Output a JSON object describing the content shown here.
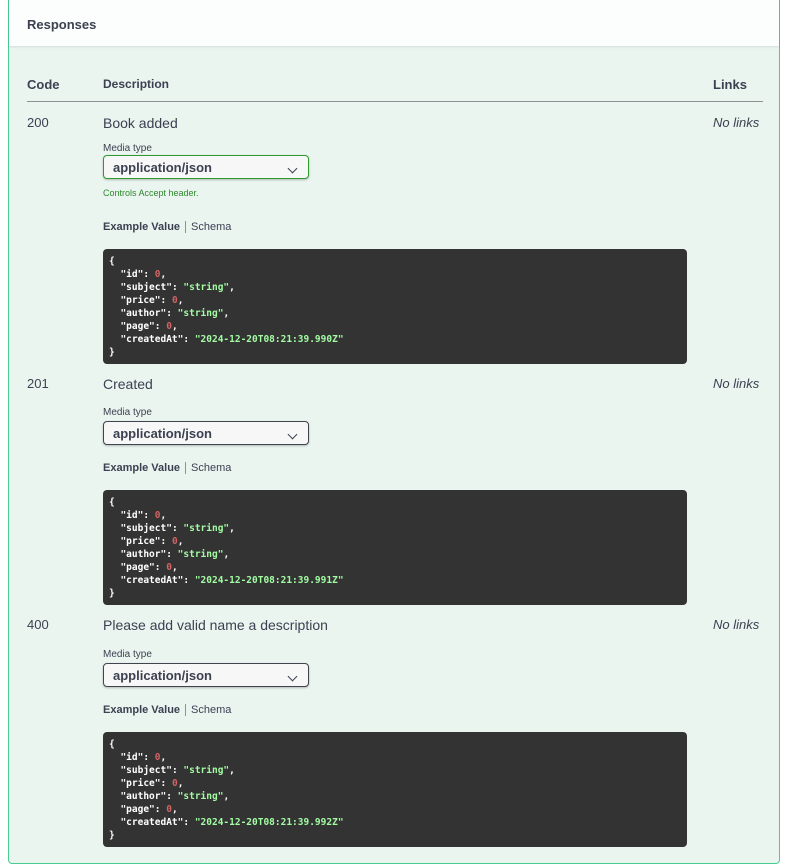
{
  "panel": {
    "title": "Responses",
    "headers": {
      "code": "Code",
      "description": "Description",
      "links": "Links"
    },
    "media_type_label": "Media type",
    "tab_example": "Example Value",
    "tab_schema": "Schema",
    "controls_note": "Controls Accept header."
  },
  "responses": [
    {
      "code": "200",
      "description": "Book added",
      "links": "No links",
      "media_type": "application/json",
      "example": {
        "open": "{",
        "close": "}",
        "fields": [
          {
            "key": "\"id\"",
            "value": "0",
            "type": "number",
            "sep": ","
          },
          {
            "key": "\"subject\"",
            "value": "\"string\"",
            "type": "string",
            "sep": ","
          },
          {
            "key": "\"price\"",
            "value": "0",
            "type": "number",
            "sep": ","
          },
          {
            "key": "\"author\"",
            "value": "\"string\"",
            "type": "string",
            "sep": ","
          },
          {
            "key": "\"page\"",
            "value": "0",
            "type": "number",
            "sep": ","
          },
          {
            "key": "\"createdAt\"",
            "value": "\"2024-12-20T08:21:39.990Z\"",
            "type": "string",
            "sep": ""
          }
        ]
      }
    },
    {
      "code": "201",
      "description": "Created",
      "links": "No links",
      "media_type": "application/json",
      "example": {
        "open": "{",
        "close": "}",
        "fields": [
          {
            "key": "\"id\"",
            "value": "0",
            "type": "number",
            "sep": ","
          },
          {
            "key": "\"subject\"",
            "value": "\"string\"",
            "type": "string",
            "sep": ","
          },
          {
            "key": "\"price\"",
            "value": "0",
            "type": "number",
            "sep": ","
          },
          {
            "key": "\"author\"",
            "value": "\"string\"",
            "type": "string",
            "sep": ","
          },
          {
            "key": "\"page\"",
            "value": "0",
            "type": "number",
            "sep": ","
          },
          {
            "key": "\"createdAt\"",
            "value": "\"2024-12-20T08:21:39.991Z\"",
            "type": "string",
            "sep": ""
          }
        ]
      }
    },
    {
      "code": "400",
      "description": "Please add valid name a description",
      "links": "No links",
      "media_type": "application/json",
      "example": {
        "open": "{",
        "close": "}",
        "fields": [
          {
            "key": "\"id\"",
            "value": "0",
            "type": "number",
            "sep": ","
          },
          {
            "key": "\"subject\"",
            "value": "\"string\"",
            "type": "string",
            "sep": ","
          },
          {
            "key": "\"price\"",
            "value": "0",
            "type": "number",
            "sep": ","
          },
          {
            "key": "\"author\"",
            "value": "\"string\"",
            "type": "string",
            "sep": ","
          },
          {
            "key": "\"page\"",
            "value": "0",
            "type": "number",
            "sep": ","
          },
          {
            "key": "\"createdAt\"",
            "value": "\"2024-12-20T08:21:39.992Z\"",
            "type": "string",
            "sep": ""
          }
        ]
      }
    }
  ],
  "colors": {
    "accent_green": "#49cc90",
    "panel_bg": "#ebf5f0",
    "code_bg": "#333333",
    "json_number": "#d36363",
    "json_string": "#a2fca2"
  }
}
